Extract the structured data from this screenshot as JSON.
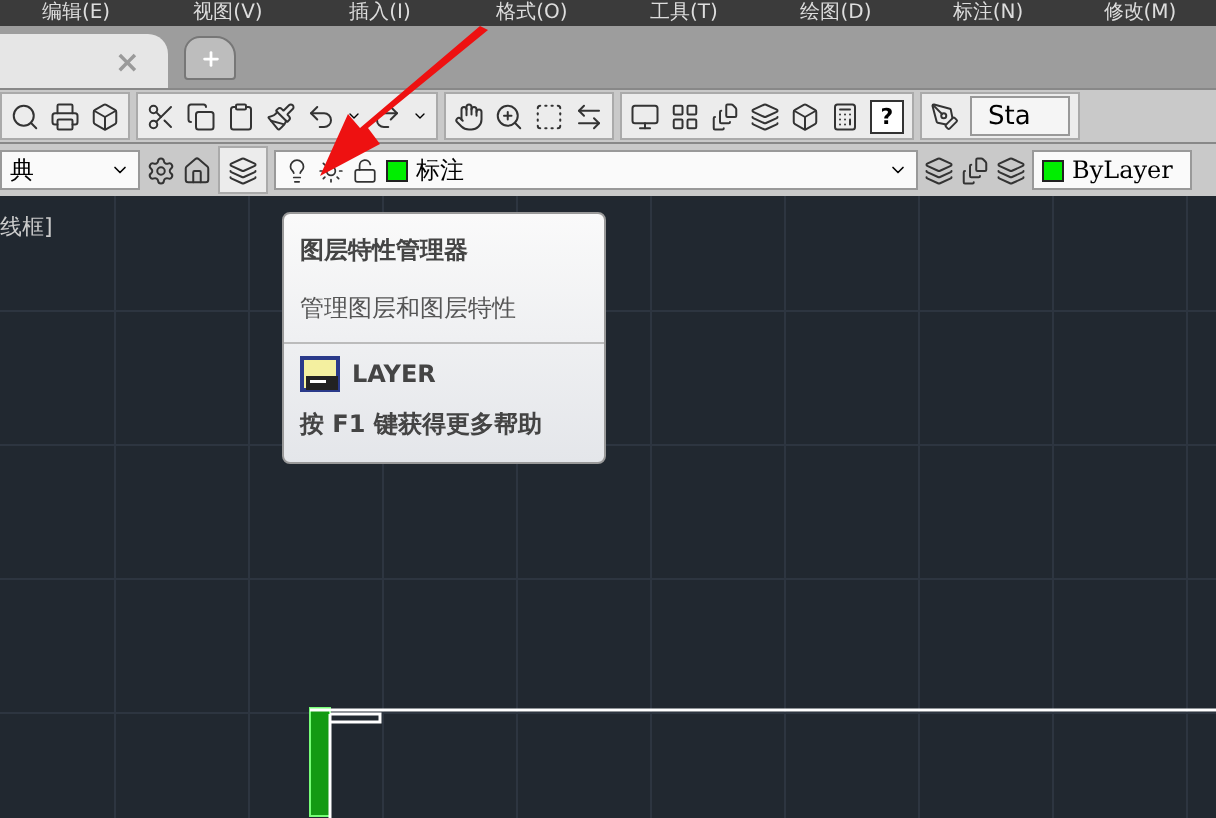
{
  "menu_bar": [
    "编辑(E)",
    "视图(V)",
    "插入(I)",
    "格式(O)",
    "工具(T)",
    "绘图(D)",
    "标注(N)",
    "修改(M)"
  ],
  "tabs": [
    {
      "close": "×",
      "selected": true
    }
  ],
  "toolbar": {
    "help": "?",
    "style_button": "Sta"
  },
  "layer_toolbar": {
    "workspace": "典",
    "layer": "标注",
    "color_control": "ByLayer"
  },
  "canvas": {
    "viewport_label": "线框]"
  },
  "tooltip": {
    "title": "图层特性管理器",
    "description": "管理图层和图层特性",
    "command": "LAYER",
    "help": "按 F1 键获得更多帮助"
  }
}
